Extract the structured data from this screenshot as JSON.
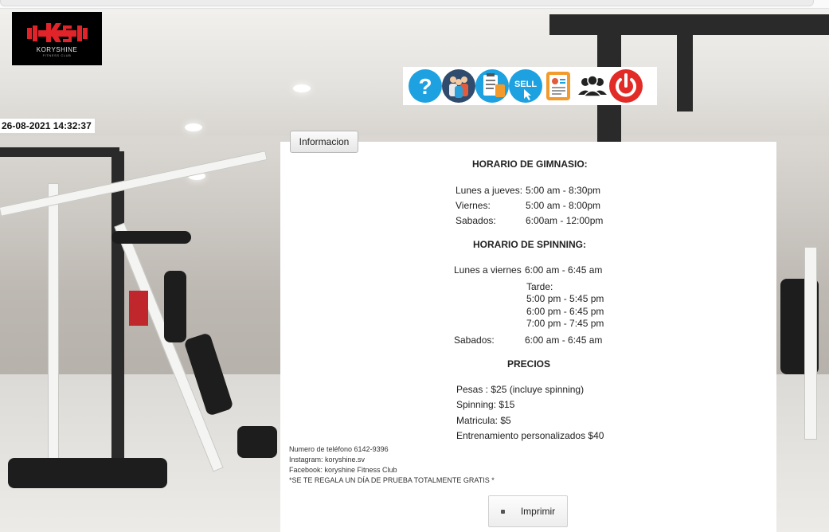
{
  "logo": {
    "brand": "KORYSHINE",
    "tagline": "FITNESS CLUB"
  },
  "datetime": "26-08-2021 14:32:37",
  "toolbar": {
    "icons": [
      "help-icon",
      "members-icon",
      "clipboard-icon",
      "sell-icon",
      "reports-icon",
      "users-group-icon",
      "power-icon"
    ],
    "sell_label": "SELL"
  },
  "info_button": "Informacion",
  "gym_schedule": {
    "title": "HORARIO DE GIMNASIO:",
    "rows": [
      {
        "day": "Lunes a jueves:",
        "hours": "5:00 am - 8:30pm"
      },
      {
        "day": "Viernes:",
        "hours": "5:00 am - 8:00pm"
      },
      {
        "day": "Sabados:",
        "hours": "6:00am - 12:00pm"
      }
    ]
  },
  "spinning_schedule": {
    "title": "HORARIO DE SPINNING:",
    "weekday_label": "Lunes a viernes",
    "weekday_morning": "6:00 am - 6:45 am",
    "afternoon_label": "Tarde:",
    "afternoon_slots": [
      "5:00 pm - 5:45 pm",
      "6:00 pm - 6:45 pm",
      "7:00 pm - 7:45 pm"
    ],
    "saturday_label": "Sabados:",
    "saturday_hours": "6:00 am - 6:45 am"
  },
  "prices": {
    "title": "PRECIOS",
    "items": [
      "Pesas : $25 (incluye spinning)",
      "Spinning: $15",
      "Matricula: $5",
      "Entrenamiento personalizados $40"
    ]
  },
  "contact": {
    "phone": "Numero de teléfono 6142-9396",
    "instagram": "Instagram: koryshine.sv",
    "facebook": "Facebook: koryshine Fitness Club",
    "promo": "*SE TE REGALA UN DÍA DE PRUEBA TOTALMENTE GRATIS *"
  },
  "print_button": "Imprimir",
  "colors": {
    "accent_blue": "#1da1e0",
    "logo_red": "#e0242a",
    "power_red": "#e22b26"
  }
}
